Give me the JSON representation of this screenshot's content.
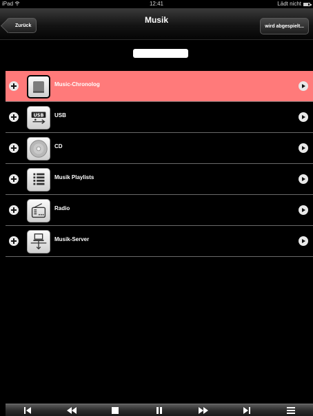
{
  "statusbar": {
    "device": "iPad",
    "time": "12:41",
    "battery_text": "Lädt nicht",
    "battery_level": 0.8
  },
  "navbar": {
    "title": "Musik",
    "back_label": "Zurück",
    "right_label": "wird abgespielt..."
  },
  "search": {
    "value": ""
  },
  "list": {
    "items": [
      {
        "label": "Music-Chronolog",
        "icon": "hard-drive-icon",
        "selected": true
      },
      {
        "label": "USB",
        "icon": "usb-icon",
        "selected": false
      },
      {
        "label": "CD",
        "icon": "cd-icon",
        "selected": false
      },
      {
        "label": "Musik Playlists",
        "icon": "playlist-icon",
        "selected": false
      },
      {
        "label": "Radio",
        "icon": "radio-icon",
        "selected": false
      },
      {
        "label": "Musik-Server",
        "icon": "server-icon",
        "selected": false
      }
    ]
  },
  "toolbar": {
    "buttons": [
      "skip-back-icon",
      "rewind-icon",
      "stop-icon",
      "pause-icon",
      "fast-forward-icon",
      "skip-forward-icon",
      "queue-icon"
    ]
  },
  "colors": {
    "selected_row": "#ff7a7a",
    "background": "#000000"
  }
}
